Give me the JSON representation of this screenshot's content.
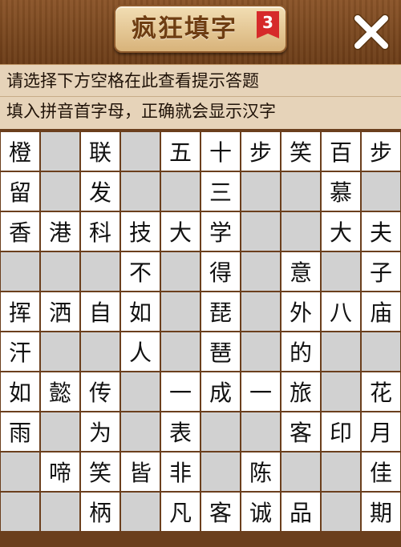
{
  "header": {
    "title": "疯狂填字",
    "level": "3"
  },
  "hint": {
    "line1": "请选择下方空格在此查看提示答题",
    "line2": "填入拼音首字母，正确就会显示汉字"
  },
  "grid": {
    "rows": [
      [
        "橙",
        "",
        "联",
        "",
        "五",
        "十",
        "步",
        "笑",
        "百",
        "步"
      ],
      [
        "留",
        "",
        "发",
        "",
        "",
        "三",
        "",
        "",
        "慕",
        ""
      ],
      [
        "香",
        "港",
        "科",
        "技",
        "大",
        "学",
        "",
        "",
        "大",
        "夫"
      ],
      [
        "",
        "",
        "",
        "不",
        "",
        "得",
        "",
        "意",
        "",
        "子"
      ],
      [
        "挥",
        "洒",
        "自",
        "如",
        "",
        "琵",
        "",
        "外",
        "八",
        "庙"
      ],
      [
        "汗",
        "",
        "",
        "人",
        "",
        "琶",
        "",
        "的",
        "",
        ""
      ],
      [
        "如",
        "懿",
        "传",
        "",
        "一",
        "成",
        "一",
        "旅",
        "",
        "花"
      ],
      [
        "雨",
        "",
        "为",
        "",
        "表",
        "",
        "",
        "客",
        "印",
        "月"
      ],
      [
        "",
        "啼",
        "笑",
        "皆",
        "非",
        "",
        "陈",
        "",
        "",
        "佳"
      ],
      [
        "",
        "",
        "柄",
        "",
        "凡",
        "客",
        "诚",
        "品",
        "",
        "期"
      ]
    ]
  },
  "colors": {
    "header_wood": "#7a4a20",
    "hint_bg": "#e6d3b9",
    "cell_filled": "#ffffff",
    "cell_blank": "#d1d1d1",
    "level_badge": "#d62a2a"
  },
  "icons": {
    "close": "close-icon"
  }
}
